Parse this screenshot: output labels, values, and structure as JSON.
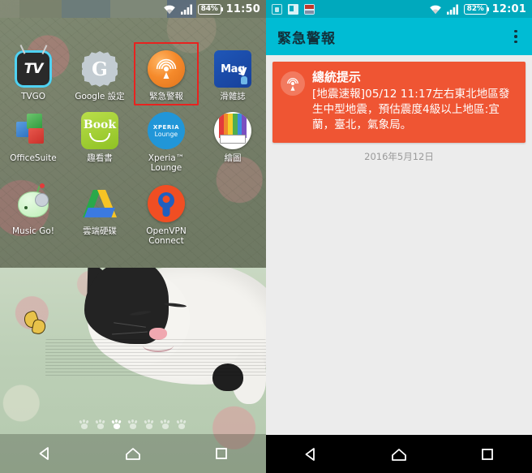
{
  "left_panel": {
    "status_bar": {
      "wifi_icon": "wifi-icon",
      "signal_icon": "cellular-signal-icon",
      "battery_text": "84%",
      "clock": "11:50"
    },
    "apps": [
      [
        {
          "label": "TVGO",
          "icon": "tvgo-icon",
          "highlighted": false
        },
        {
          "label": "Google 設定",
          "icon": "google-settings-icon",
          "highlighted": false
        },
        {
          "label": "緊急警報",
          "icon": "emergency-alert-icon",
          "highlighted": true
        },
        {
          "label": "滑雜誌",
          "icon": "magv-icon",
          "highlighted": false
        }
      ],
      [
        {
          "label": "OfficeSuite",
          "icon": "officesuite-icon",
          "highlighted": false
        },
        {
          "label": "趣看書",
          "icon": "book-icon",
          "highlighted": false
        },
        {
          "label": "Xperia™ Lounge",
          "icon": "xperia-lounge-icon",
          "highlighted": false
        },
        {
          "label": "繪圖",
          "icon": "drawing-icon",
          "highlighted": false
        }
      ],
      [
        {
          "label": "Music Go!",
          "icon": "music-go-icon",
          "highlighted": false
        },
        {
          "label": "雲端硬碟",
          "icon": "google-drive-icon",
          "highlighted": false
        },
        {
          "label": "OpenVPN Connect",
          "icon": "openvpn-icon",
          "highlighted": false
        }
      ]
    ],
    "page_indicator": {
      "total": 7,
      "active_index": 2,
      "style": "paw-print"
    },
    "icon_labels": {
      "tvgo_glyph": "TV",
      "google_glyph": "G",
      "magv_glyph": "Mag",
      "magv_v": "V",
      "book_glyph": "Book",
      "xperia_line1": "XPERIA",
      "xperia_line2": "Lounge"
    },
    "nav_bar": {
      "back": "back-icon",
      "home": "home-icon",
      "recents": "recents-icon"
    },
    "highlight_color": "#e8231f"
  },
  "right_panel": {
    "status_bar": {
      "notif_icons": [
        "sim-card-icon",
        "sd-card-icon",
        "news-icon"
      ],
      "wifi_icon": "wifi-icon",
      "signal_icon": "cellular-signal-icon",
      "battery_text": "82%",
      "clock": "12:01",
      "bg_color": "#00a9bd"
    },
    "app_bar": {
      "title": "緊急警報",
      "overflow_menu": "overflow-menu-icon",
      "bg_color": "#00bcd4"
    },
    "alert": {
      "badge_icon": "broadcast-alert-icon",
      "title": "總統提示",
      "body": "[地震速報]05/12 11:17左右東北地區發生中型地震，預估震度4級以上地區:宜蘭，臺北，氣象局。",
      "date": "2016年5月12日",
      "card_color": "#ef5533"
    },
    "body_bg": "#ececec",
    "nav_bar": {
      "back": "back-icon",
      "home": "home-icon",
      "recents": "recents-icon"
    }
  }
}
